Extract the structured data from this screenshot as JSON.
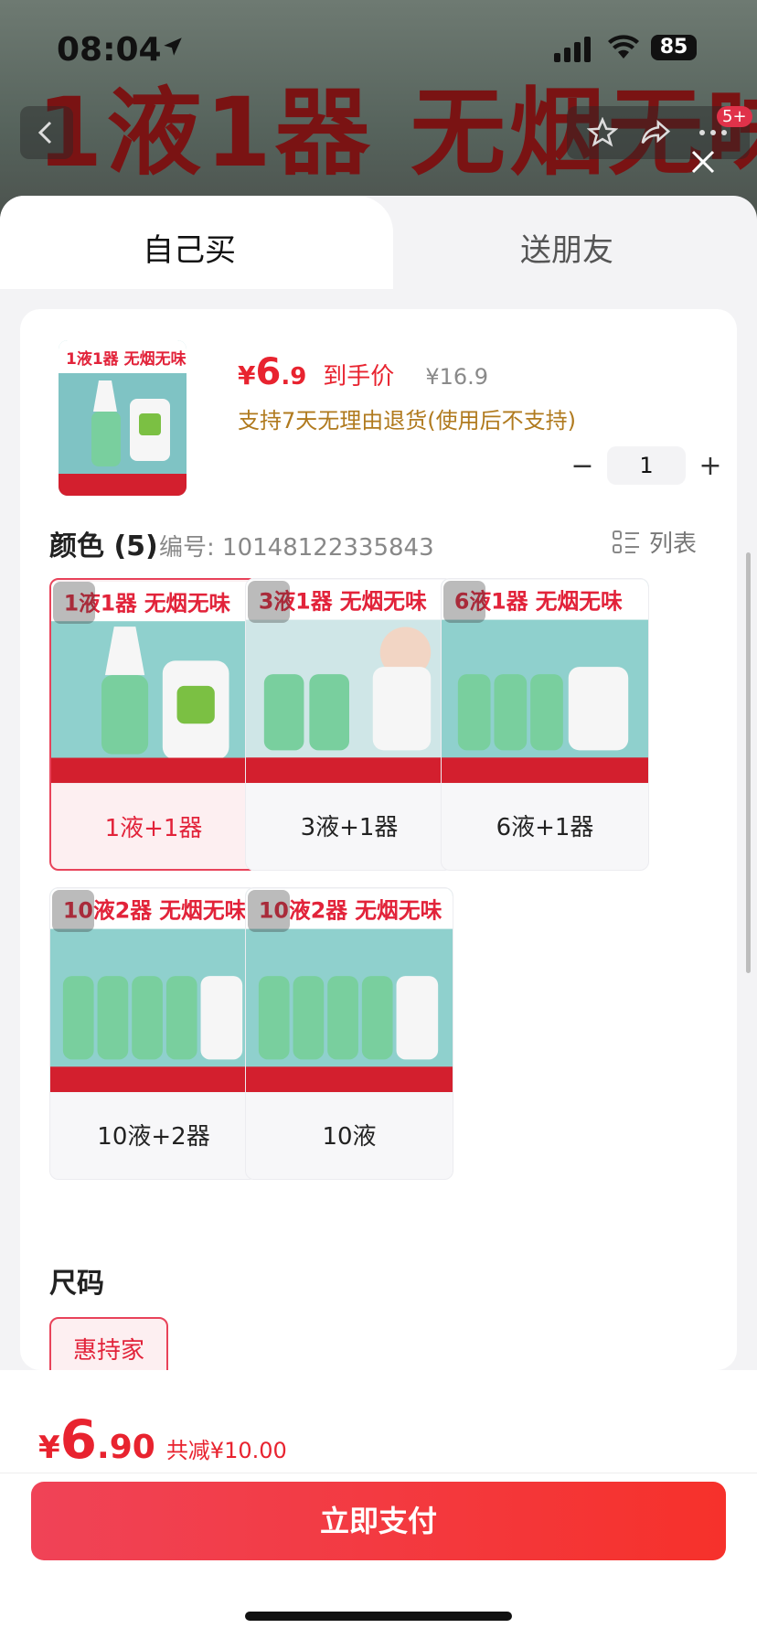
{
  "status_bar": {
    "time": "08:04",
    "battery": "85"
  },
  "background": {
    "headline": "1液1器 无烟无味",
    "badge": "5+"
  },
  "tabs": [
    {
      "label": "自己买"
    },
    {
      "label": "送朋友"
    }
  ],
  "product": {
    "price_symbol": "¥",
    "price_integer": "6",
    "price_decimal": ".9",
    "price_label": "到手价",
    "original_price": "¥16.9",
    "return_note": "支持7天无理由退货(使用后不支持)",
    "quantity": "1",
    "thumb_banner": "1液1器 无烟无味"
  },
  "color_section": {
    "title": "颜色 (5)",
    "sku_label": "编号: 10148122335843",
    "list_label": "列表",
    "options": [
      {
        "label": "1液+1器",
        "banner": "1液1器 无烟无味",
        "selected": true
      },
      {
        "label": "3液+1器",
        "banner": "3液1器 无烟无味",
        "selected": false
      },
      {
        "label": "6液+1器",
        "banner": "6液1器 无烟无味",
        "selected": false
      },
      {
        "label": "10液+2器",
        "banner": "10液2器 无烟无味",
        "selected": false
      },
      {
        "label": "10液",
        "banner": "10液2器 无烟无味",
        "selected": false
      }
    ]
  },
  "size_section": {
    "title": "尺码",
    "options": [
      {
        "label": "惠持家",
        "selected": true
      }
    ]
  },
  "bottom": {
    "total_symbol": "¥",
    "total_integer": "6",
    "total_decimal": ".90",
    "total_save": "共减¥10.00",
    "pay_label": "立即支付"
  },
  "colors": {
    "accent": "#e8232f",
    "selected_bg": "#fdeff1",
    "return_note": "#b07a1e"
  }
}
